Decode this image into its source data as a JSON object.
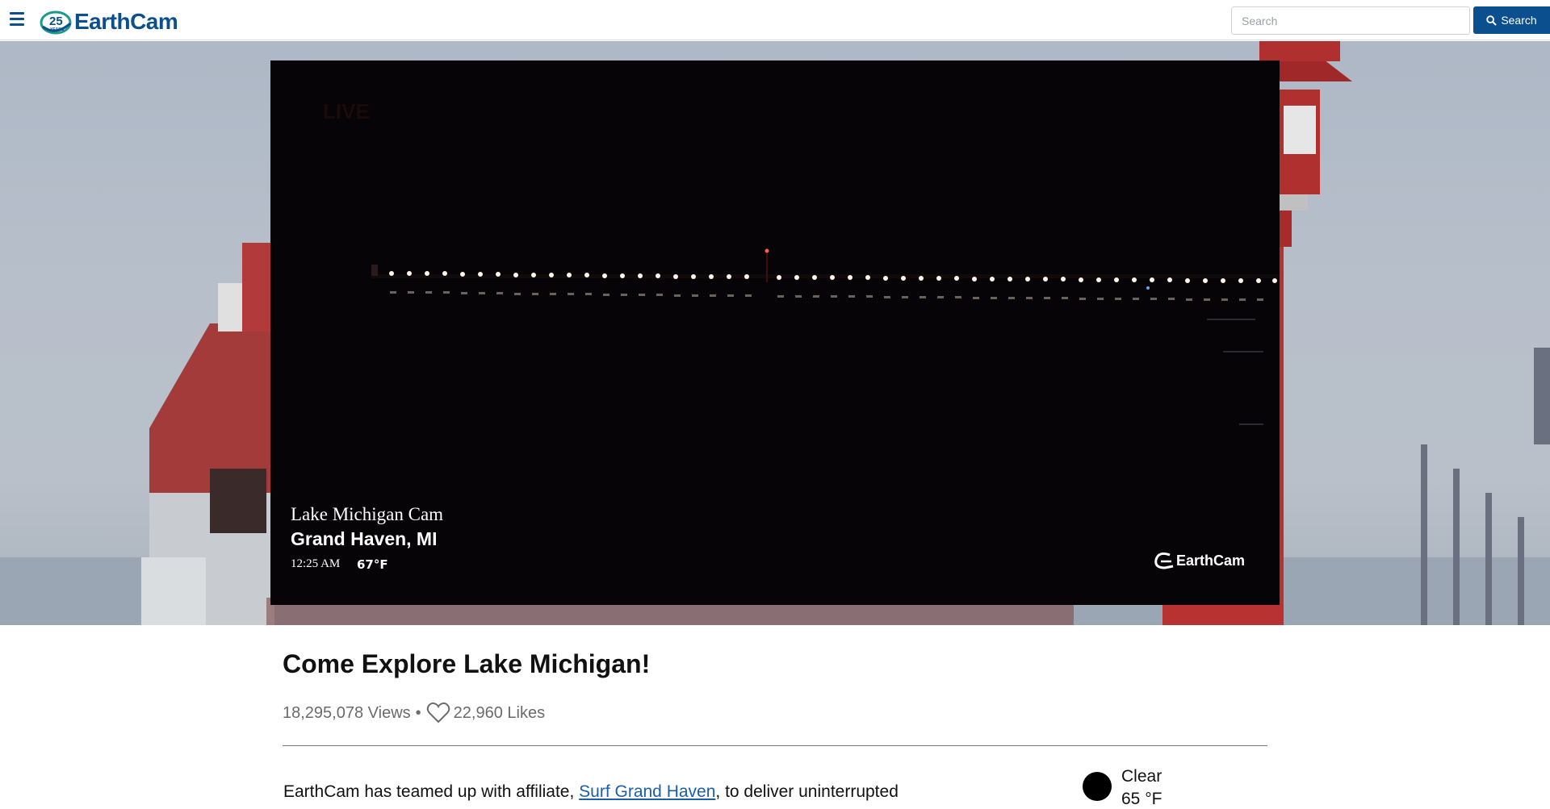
{
  "header": {
    "menu_icon": "hamburger-menu-icon",
    "logo_badge_text": "25 YEARS",
    "logo_text": "EarthCam",
    "search_placeholder": "Search",
    "search_button_label": "Search",
    "search_button_icon": "search-icon",
    "brand_color": "#0b4f8f"
  },
  "player": {
    "live_label": "LIVE",
    "cam_title": "Lake Michigan Cam",
    "location": "Grand Haven, MI",
    "time": "12:25 AM",
    "temperature": "67°F",
    "watermark": "EarthCam"
  },
  "content": {
    "heading": "Come Explore Lake Michigan!",
    "views": "18,295,078 Views",
    "separator": "•",
    "likes": "22,960 Likes",
    "like_icon": "heart-icon",
    "description_before": "EarthCam has teamed up with affiliate, ",
    "description_link": "Surf Grand Haven",
    "description_after": ", to deliver uninterrupted",
    "link_color": "#1a5fa8"
  },
  "weather": {
    "icon": "moon-icon",
    "condition": "Clear",
    "temperature": "65 °F"
  }
}
